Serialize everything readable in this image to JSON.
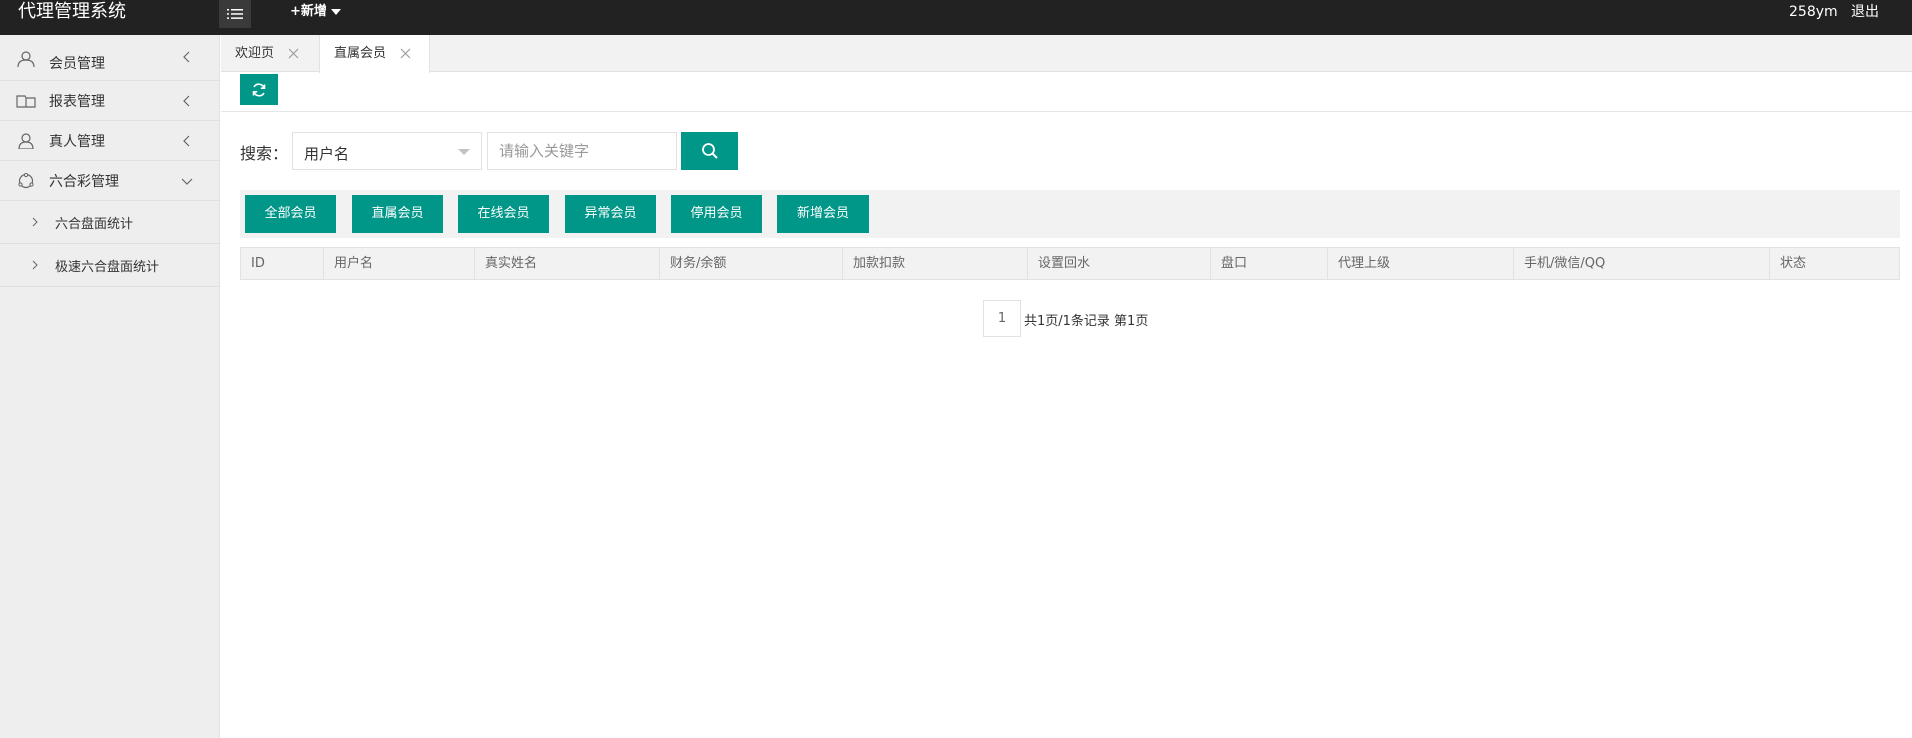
{
  "app": {
    "title": "代理管理系统"
  },
  "header": {
    "menu_toggle_icon": "list-icon",
    "add_new_label": "+新增",
    "username": "258ym",
    "logout_label": "退出"
  },
  "sidebar": {
    "items": [
      {
        "label": "会员管理",
        "icon": "user-icon",
        "expanded": false
      },
      {
        "label": "报表管理",
        "icon": "report-icon",
        "expanded": false
      },
      {
        "label": "真人管理",
        "icon": "person-icon",
        "expanded": false
      },
      {
        "label": "六合彩管理",
        "icon": "lottery-icon",
        "expanded": true
      }
    ],
    "subitems": [
      {
        "label": "六合盘面统计"
      },
      {
        "label": "极速六合盘面统计"
      }
    ]
  },
  "tabs": [
    {
      "label": "欢迎页",
      "active": false
    },
    {
      "label": "直属会员",
      "active": true
    }
  ],
  "search": {
    "label": "搜索：",
    "field_selected": "用户名",
    "keyword_placeholder": "请输入关键字",
    "keyword_value": ""
  },
  "filters": [
    {
      "label": "全部会员"
    },
    {
      "label": "直属会员"
    },
    {
      "label": "在线会员"
    },
    {
      "label": "异常会员"
    },
    {
      "label": "停用会员"
    },
    {
      "label": "新增会员"
    }
  ],
  "table": {
    "columns": [
      "ID",
      "用户名",
      "真实姓名",
      "财务/余额",
      "加款扣款",
      "设置回水",
      "盘口",
      "代理上级",
      "手机/微信/QQ",
      "状态"
    ],
    "rows": []
  },
  "pagination": {
    "current_page": "1",
    "info": "共1页/1条记录 第1页"
  },
  "colors": {
    "accent": "#009688",
    "topbar": "#222222",
    "sidebar_bg": "#eeeeee"
  }
}
